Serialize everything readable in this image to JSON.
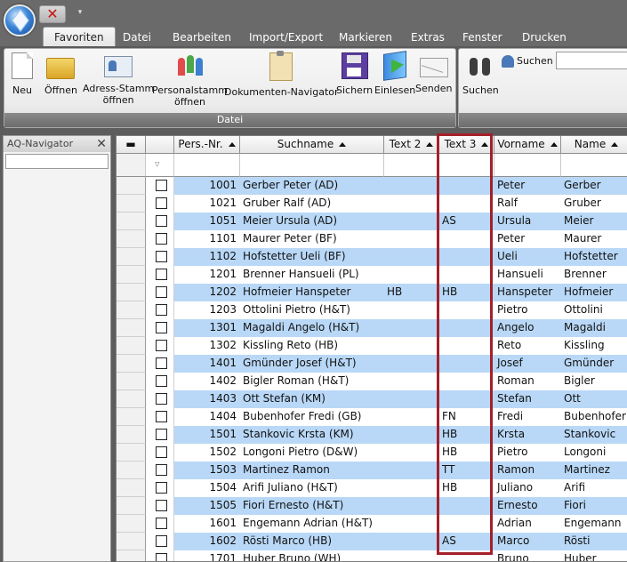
{
  "quick_access": {
    "close_symbol": "✕",
    "dropdown_symbol": "▾"
  },
  "tabs": [
    "Favoriten",
    "Datei",
    "Bearbeiten",
    "Import/Export",
    "Markieren",
    "Extras",
    "Fenster",
    "Drucken"
  ],
  "ribbon": {
    "group_title": "Datei",
    "buttons": [
      {
        "line1": "Neu",
        "line2": ""
      },
      {
        "line1": "Öffnen",
        "line2": ""
      },
      {
        "line1": "Adress-Stamm",
        "line2": "öffnen"
      },
      {
        "line1": "Personalstamm",
        "line2": "öffnen"
      },
      {
        "line1": "Dokumenten-Navigator",
        "line2": ""
      },
      {
        "line1": "Sichern",
        "line2": ""
      },
      {
        "line1": "Einlesen",
        "line2": ""
      },
      {
        "line1": "Senden",
        "line2": ""
      }
    ],
    "search_button": "Suchen",
    "search_label": "Suchen"
  },
  "navigator": {
    "title": "AQ-Navigator",
    "close_symbol": "✕"
  },
  "grid": {
    "filter_symbol": "▿",
    "columns": [
      "",
      "",
      "Pers.-Nr.",
      "Suchname",
      "Text 2",
      "Text 3",
      "Vorname",
      "Name"
    ],
    "header_minus": "▬",
    "rows": [
      {
        "nr": "1001",
        "such": "Gerber Peter (AD)",
        "t2": "",
        "t3": "",
        "vor": "Peter",
        "name": "Gerber"
      },
      {
        "nr": "1021",
        "such": "Gruber Ralf (AD)",
        "t2": "",
        "t3": "",
        "vor": "Ralf",
        "name": "Gruber"
      },
      {
        "nr": "1051",
        "such": "Meier Ursula (AD)",
        "t2": "",
        "t3": "AS",
        "vor": "Ursula",
        "name": "Meier"
      },
      {
        "nr": "1101",
        "such": "Maurer Peter (BF)",
        "t2": "",
        "t3": "",
        "vor": "Peter",
        "name": "Maurer"
      },
      {
        "nr": "1102",
        "such": "Hofstetter Ueli (BF)",
        "t2": "",
        "t3": "",
        "vor": "Ueli",
        "name": "Hofstetter"
      },
      {
        "nr": "1201",
        "such": "Brenner Hansueli (PL)",
        "t2": "",
        "t3": "",
        "vor": "Hansueli",
        "name": "Brenner"
      },
      {
        "nr": "1202",
        "such": "Hofmeier Hanspeter",
        "t2": "HB",
        "t3": "HB",
        "vor": "Hanspeter",
        "name": "Hofmeier"
      },
      {
        "nr": "1203",
        "such": "Ottolini Pietro (H&T)",
        "t2": "",
        "t3": "",
        "vor": "Pietro",
        "name": "Ottolini"
      },
      {
        "nr": "1301",
        "such": "Magaldi Angelo (H&T)",
        "t2": "",
        "t3": "",
        "vor": "Angelo",
        "name": "Magaldi"
      },
      {
        "nr": "1302",
        "such": "Kissling Reto (HB)",
        "t2": "",
        "t3": "",
        "vor": "Reto",
        "name": "Kissling"
      },
      {
        "nr": "1401",
        "such": "Gmünder Josef (H&T)",
        "t2": "",
        "t3": "",
        "vor": "Josef",
        "name": "Gmünder"
      },
      {
        "nr": "1402",
        "such": "Bigler Roman (H&T)",
        "t2": "",
        "t3": "",
        "vor": "Roman",
        "name": "Bigler"
      },
      {
        "nr": "1403",
        "such": "Ott Stefan (KM)",
        "t2": "",
        "t3": "",
        "vor": "Stefan",
        "name": "Ott"
      },
      {
        "nr": "1404",
        "such": "Bubenhofer Fredi (GB)",
        "t2": "",
        "t3": "FN",
        "vor": "Fredi",
        "name": "Bubenhofer"
      },
      {
        "nr": "1501",
        "such": "Stankovic Krsta (KM)",
        "t2": "",
        "t3": "HB",
        "vor": "Krsta",
        "name": "Stankovic"
      },
      {
        "nr": "1502",
        "such": "Longoni Pietro (D&W)",
        "t2": "",
        "t3": "HB",
        "vor": "Pietro",
        "name": "Longoni"
      },
      {
        "nr": "1503",
        "such": "Martinez Ramon",
        "t2": "",
        "t3": "TT",
        "vor": "Ramon",
        "name": "Martinez"
      },
      {
        "nr": "1504",
        "such": "Arifi Juliano (H&T)",
        "t2": "",
        "t3": "HB",
        "vor": "Juliano",
        "name": "Arifi"
      },
      {
        "nr": "1505",
        "such": "Fiori Ernesto (H&T)",
        "t2": "",
        "t3": "",
        "vor": "Ernesto",
        "name": "Fiori"
      },
      {
        "nr": "1601",
        "such": "Engemann Adrian (H&T)",
        "t2": "",
        "t3": "",
        "vor": "Adrian",
        "name": "Engemann"
      },
      {
        "nr": "1602",
        "such": "Rösti Marco (HB)",
        "t2": "",
        "t3": "AS",
        "vor": "Marco",
        "name": "Rösti"
      },
      {
        "nr": "1701",
        "such": "Huber Bruno (WH)",
        "t2": "",
        "t3": "",
        "vor": "Bruno",
        "name": "Huber"
      }
    ]
  },
  "colors": {
    "row_alt": "#b9d8f7",
    "highlight": "#a3202a"
  }
}
